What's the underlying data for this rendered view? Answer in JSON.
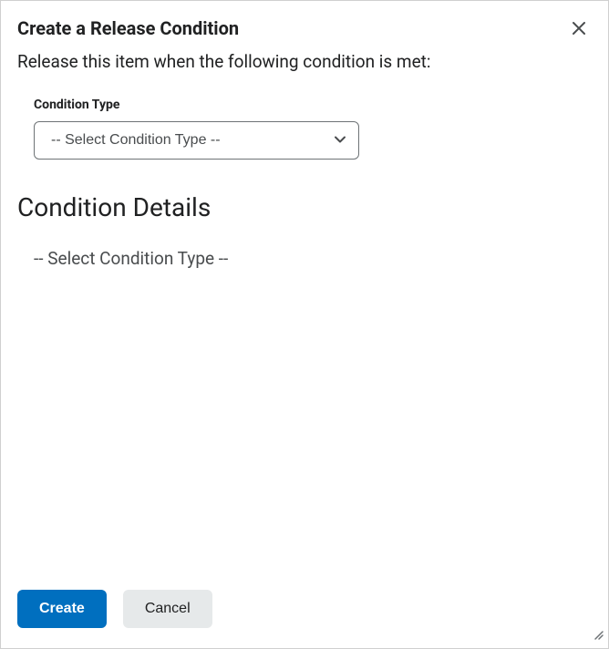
{
  "dialog": {
    "title": "Create a Release Condition",
    "subtitle": "Release this item when the following condition is met:"
  },
  "conditionType": {
    "label": "Condition Type",
    "selected": "-- Select Condition Type --"
  },
  "details": {
    "heading": "Condition Details",
    "placeholder": "-- Select Condition Type --"
  },
  "footer": {
    "createLabel": "Create",
    "cancelLabel": "Cancel"
  }
}
